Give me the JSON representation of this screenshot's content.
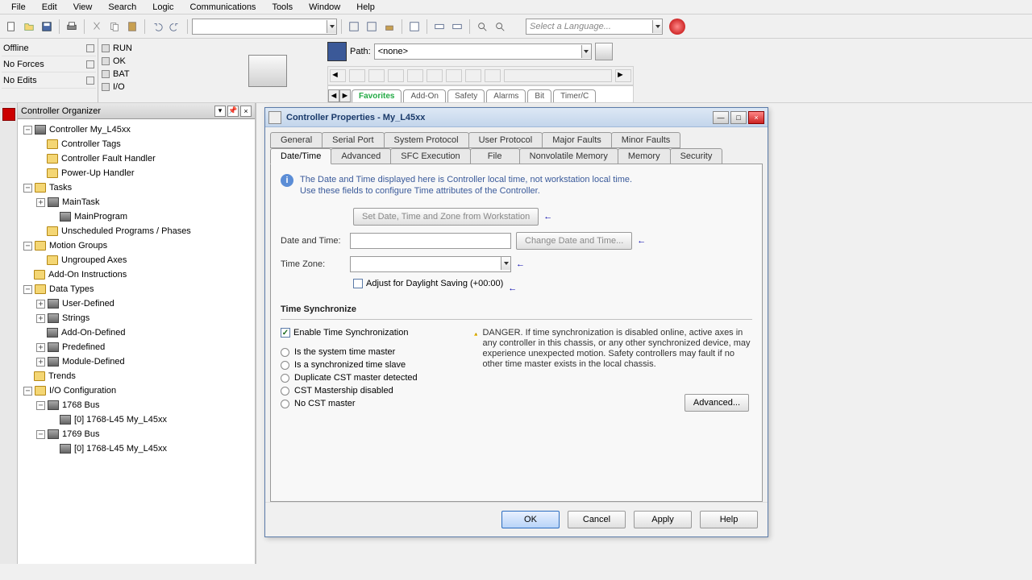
{
  "menu": {
    "items": [
      "File",
      "Edit",
      "View",
      "Search",
      "Logic",
      "Communications",
      "Tools",
      "Window",
      "Help"
    ]
  },
  "toolbar": {
    "language_placeholder": "Select a Language..."
  },
  "status": {
    "offline": "Offline",
    "noforces": "No Forces",
    "noedits": "No Edits",
    "leds": [
      "RUN",
      "OK",
      "BAT",
      "I/O"
    ]
  },
  "path": {
    "label": "Path:",
    "value": "<none>"
  },
  "ladder_tabs": {
    "active": "Favorites",
    "items": [
      "Add-On",
      "Safety",
      "Alarms",
      "Bit",
      "Timer/C"
    ]
  },
  "organizer": {
    "title": "Controller Organizer",
    "nodes": {
      "controller": {
        "label": "Controller My_L45xx",
        "children": [
          "Controller Tags",
          "Controller Fault Handler",
          "Power-Up Handler"
        ]
      },
      "tasks": {
        "label": "Tasks",
        "maintask": "MainTask",
        "mainprog": "MainProgram",
        "unsched": "Unscheduled Programs / Phases"
      },
      "motion": {
        "label": "Motion Groups",
        "ungrouped": "Ungrouped Axes"
      },
      "addon": "Add-On Instructions",
      "datatypes": {
        "label": "Data Types",
        "children": [
          "User-Defined",
          "Strings",
          "Add-On-Defined",
          "Predefined",
          "Module-Defined"
        ]
      },
      "trends": "Trends",
      "io": {
        "label": "I/O Configuration",
        "bus1": "1768 Bus",
        "slot0": "[0] 1768-L45 My_L45xx",
        "bus2": "1769 Bus",
        "slot0b": "[0] 1768-L45 My_L45xx"
      }
    }
  },
  "dialog": {
    "title": "Controller Properties - My_L45xx",
    "tabs_row1": [
      "General",
      "Serial Port",
      "System Protocol",
      "User Protocol",
      "Major Faults",
      "Minor Faults"
    ],
    "tabs_row2": [
      "Date/Time",
      "Advanced",
      "SFC Execution",
      "File",
      "Nonvolatile Memory",
      "Memory",
      "Security"
    ],
    "active_tab": "Date/Time",
    "info1": "The Date and Time displayed here is Controller local time, not workstation local time.",
    "info2": "Use these fields to configure Time attributes of the Controller.",
    "btn_set_from_ws": "Set Date, Time and Zone from Workstation",
    "lbl_datetime": "Date and Time:",
    "btn_change_dt": "Change Date and Time...",
    "lbl_tz": "Time Zone:",
    "chk_dst": "Adjust for Daylight Saving (+00:00)",
    "ts_heading": "Time Synchronize",
    "chk_enable_ts": "Enable Time Synchronization",
    "radios": [
      "Is the system time master",
      "Is a synchronized time slave",
      "Duplicate CST master detected",
      "CST Mastership disabled",
      "No CST master"
    ],
    "warning": "DANGER. If time synchronization is disabled online, active axes in any controller in this chassis, or any other synchronized device, may experience unexpected motion.  Safety controllers may fault if no other time master exists in the local chassis.",
    "btn_advanced": "Advanced...",
    "btn_ok": "OK",
    "btn_cancel": "Cancel",
    "btn_apply": "Apply",
    "btn_help": "Help"
  }
}
